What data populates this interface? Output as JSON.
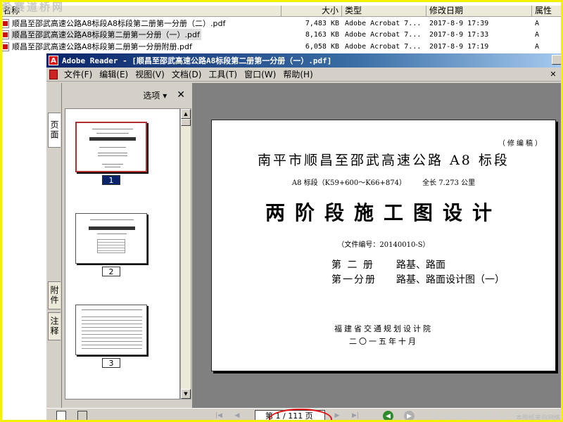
{
  "explorer": {
    "watermark": "希赛道桥网",
    "columns": {
      "name": "名称",
      "size": "大小",
      "type": "类型",
      "date": "修改日期",
      "attr": "属性"
    },
    "files": [
      {
        "name": "顺昌至邵武高速公路A8标段A8标段第二册第一分册（二）.pdf",
        "size": "7,483 KB",
        "type": "Adobe Acrobat 7...",
        "date": "2017-8-9 17:39",
        "attr": "A"
      },
      {
        "name": "顺昌至邵武高速公路A8标段第二册第一分册（一）.pdf",
        "size": "8,163 KB",
        "type": "Adobe Acrobat 7...",
        "date": "2017-8-9 17:33",
        "attr": "A"
      },
      {
        "name": "顺昌至邵武高速公路A8标段第二册第一分册附册.pdf",
        "size": "6,058 KB",
        "type": "Adobe Acrobat 7...",
        "date": "2017-8-9 17:19",
        "attr": "A"
      }
    ]
  },
  "reader": {
    "title": "Adobe Reader - [顺昌至邵武高速公路A8标段第二册第一分册（一）.pdf]",
    "menu": [
      "文件(F)",
      "编辑(E)",
      "视图(V)",
      "文档(D)",
      "工具(T)",
      "窗口(W)",
      "帮助(H)"
    ],
    "nav_tabs": {
      "pages": "页面",
      "attachments": "附件",
      "comments": "注释"
    },
    "panel": {
      "options": "选项 ▾",
      "close": "✕"
    },
    "thumbnails": [
      "1",
      "2",
      "3"
    ],
    "document": {
      "edition": "（修编稿）",
      "project": "南平市顺昌至邵武高速公路 A8 标段",
      "section": "A8 标段（K59+600～K66+874）",
      "length": "全长 7.273 公里",
      "title": "两阶段施工图设计",
      "file_no": "（文件编号：20140010-S）",
      "volume_label": "第 二 册",
      "volume_text": "路基、路面",
      "subvolume_label": "第一分册",
      "subvolume_text": "路基、路面设计图（一）",
      "org": "福建省交通规划设计院",
      "date": "二〇一五年十月"
    },
    "status": {
      "page_display": "第 1 / 111 页",
      "watermark": "www.cadtu.com",
      "watermark_small": "本图纸来自网络"
    }
  },
  "colors": {
    "title_bar": "#0a246a",
    "frame": "#f5f000",
    "annotation": "#e01010"
  }
}
